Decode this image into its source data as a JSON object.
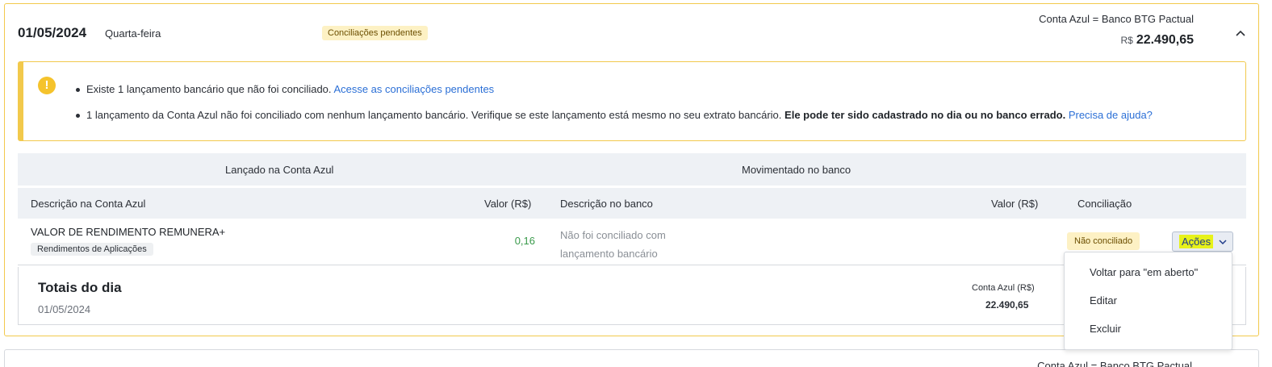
{
  "day": {
    "date": "01/05/2024",
    "weekday": "Quarta-feira",
    "badge": "Conciliações pendentes",
    "account_label": "Conta Azul = Banco BTG Pactual",
    "currency": "R$",
    "balance": "22.490,65"
  },
  "alert": {
    "item1_text": "Existe 1 lançamento bancário que não foi conciliado.",
    "item1_link": "Acesse as conciliações pendentes",
    "item2_text": "1 lançamento da Conta Azul não foi conciliado com nenhum lançamento bancário. Verifique se este lançamento está mesmo no seu extrato bancário.",
    "item2_bold": "Ele pode ter sido cadastrado no dia ou no banco errado.",
    "item2_link": "Precisa de ajuda?"
  },
  "table": {
    "group_left": "Lançado na Conta Azul",
    "group_right": "Movimentado no banco",
    "columns": [
      "Descrição na Conta Azul",
      "Valor (R$)",
      "Descrição no banco",
      "Valor (R$)",
      "Conciliação"
    ],
    "rows": [
      {
        "description": "VALOR DE RENDIMENTO REMUNERA+",
        "category": "Rendimentos de Aplicações",
        "value": "0,16",
        "bank_line1": "Não foi conciliado com",
        "bank_line2": "lançamento bancário",
        "status": "Não conciliado",
        "actions_label": "Ações"
      }
    ]
  },
  "totals": {
    "title": "Totais do dia",
    "date": "01/05/2024",
    "account_label": "Conta Azul (R$)",
    "account_value": "22.490,65"
  },
  "menu": {
    "items": [
      "Voltar para \"em aberto\"",
      "Editar",
      "Excluir"
    ]
  },
  "next_day": {
    "account_label": "Conta Azul = Banco BTG Pactual"
  },
  "colors": {
    "warning_border": "#f2c94c",
    "badge_bg": "#fdf1c4",
    "positive_value": "#3a9a4b",
    "link": "#2b6fd6",
    "actions_highlight": "#e7f21a"
  }
}
